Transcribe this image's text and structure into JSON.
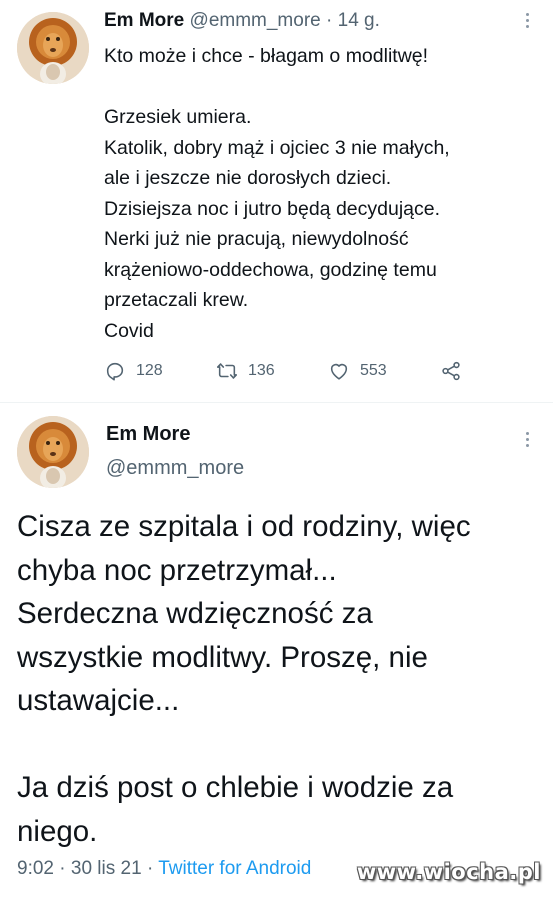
{
  "tweet1": {
    "name": "Em More",
    "handle": "@emmm_more",
    "separator": "·",
    "time": "14 g.",
    "lines": [
      "Kto może i chce - błagam o modlitwę!",
      "",
      "Grzesiek umiera.",
      "Katolik, dobry mąż i ojciec 3 nie małych,",
      "ale i jeszcze nie dorosłych dzieci.",
      "Dzisiejsza noc i jutro będą decydujące.",
      "Nerki już nie pracują, niewydolność",
      "krążeniowo-oddechowa, godzinę temu",
      "przetaczali krew.",
      "Covid"
    ],
    "replies": "128",
    "retweets": "136",
    "likes": "553"
  },
  "tweet2": {
    "name": "Em More",
    "handle": "@emmm_more",
    "lines": [
      "Cisza ze szpitala i od rodziny, więc",
      "chyba noc przetrzymał...",
      "Serdeczna wdzięczność za",
      "wszystkie modlitwy. Proszę, nie",
      "ustawajcie...",
      "",
      "Ja dziś post o chlebie i wodzie za",
      "niego."
    ],
    "time": "9:02",
    "separator1": "·",
    "date": "30 lis 21",
    "separator2": "·",
    "source": "Twitter for Android"
  },
  "watermark": "www.wiocha.pl",
  "colors": {
    "text": "#0f1419",
    "secondary": "#536471",
    "link": "#1d9bf0"
  },
  "icons": {
    "reply": "reply-icon",
    "retweet": "retweet-icon",
    "like": "heart-icon",
    "share": "share-icon",
    "more": "more-vertical-icon"
  }
}
